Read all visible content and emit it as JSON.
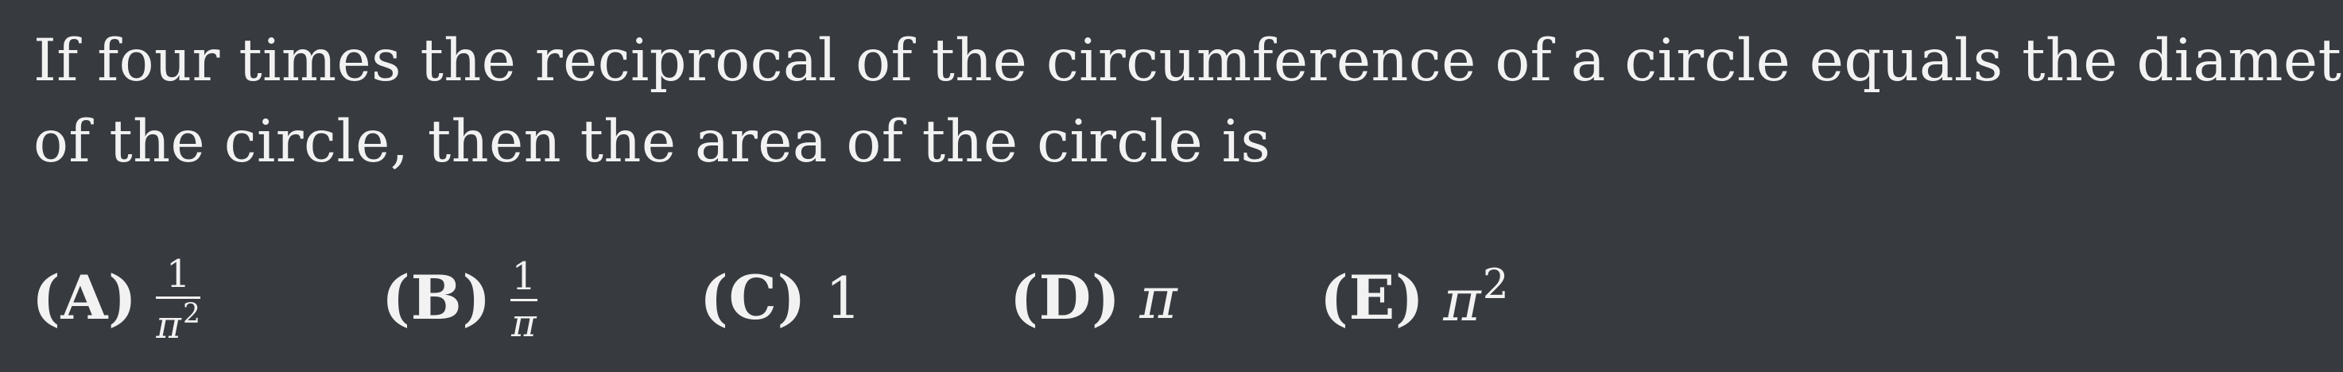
{
  "question": {
    "line1": "If four times the reciprocal of the circumference of a circle equals the diameter",
    "line2": "of the circle, then the area of the circle is"
  },
  "choices": [
    {
      "label": "(A)",
      "numerator": "1",
      "denominator_base": "π",
      "denominator_exp": "2"
    },
    {
      "label": "(B)",
      "numerator": "1",
      "denominator": "π"
    },
    {
      "label": "(C)",
      "value": "1"
    },
    {
      "label": "(D)",
      "value": "π"
    },
    {
      "label": "(E)",
      "base": "π",
      "exp": "2"
    }
  ]
}
